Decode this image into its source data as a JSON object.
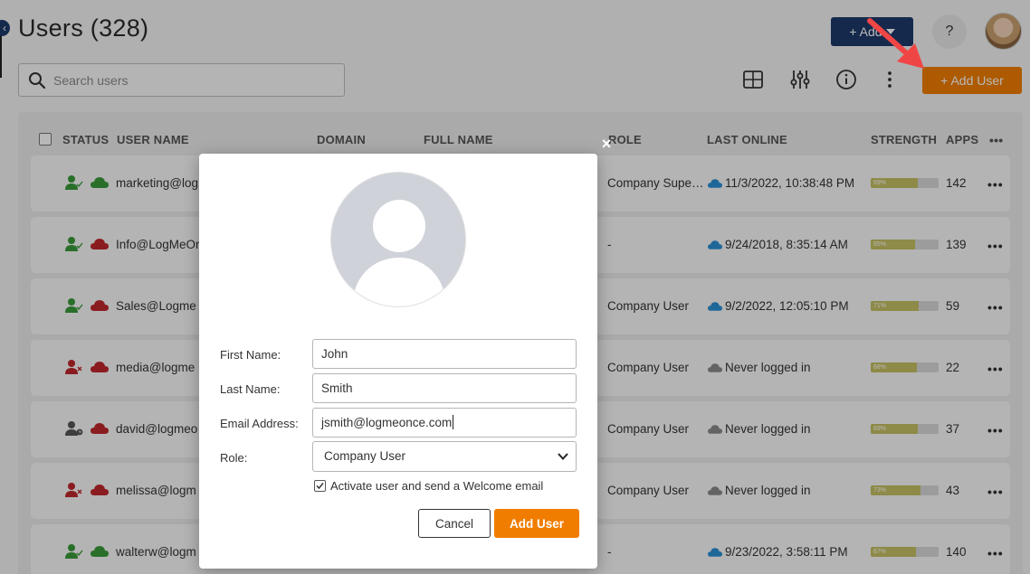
{
  "header": {
    "title": "Users (328)",
    "add_label": "+ Add",
    "help_label": "?",
    "add_user_label": "+ Add User"
  },
  "search": {
    "placeholder": "Search users"
  },
  "table": {
    "columns": [
      "STATUS",
      "USER NAME",
      "DOMAIN",
      "FULL NAME",
      "ROLE",
      "LAST ONLINE",
      "STRENGTH",
      "APPS"
    ],
    "more_label": "•••",
    "rows": [
      {
        "username": "marketing@log",
        "role": "Company Supe…",
        "last_online": "11/3/2022, 10:38:48 PM",
        "strength": 69,
        "strength_label": "69%",
        "apps": "142",
        "status_user": "active",
        "status_cloud": "green",
        "online_cloud": "blue"
      },
      {
        "username": "Info@LogMeOr",
        "role": "-",
        "last_online": "9/24/2018, 8:35:14 AM",
        "strength": 65,
        "strength_label": "65%",
        "apps": "139",
        "status_user": "active",
        "status_cloud": "red",
        "online_cloud": "blue"
      },
      {
        "username": "Sales@Logme",
        "role": "Company User",
        "last_online": "9/2/2022, 12:05:10 PM",
        "strength": 71,
        "strength_label": "71%",
        "apps": "59",
        "status_user": "active",
        "status_cloud": "red",
        "online_cloud": "blue"
      },
      {
        "username": "media@logme",
        "role": "Company User",
        "last_online": "Never logged in",
        "strength": 68,
        "strength_label": "68%",
        "apps": "22",
        "status_user": "inactive",
        "status_cloud": "red",
        "online_cloud": "grey"
      },
      {
        "username": "david@logmeo",
        "role": "Company User",
        "last_online": "Never logged in",
        "strength": 69,
        "strength_label": "69%",
        "apps": "37",
        "status_user": "pending",
        "status_cloud": "red",
        "online_cloud": "grey"
      },
      {
        "username": "melissa@logm",
        "role": "Company User",
        "last_online": "Never logged in",
        "strength": 73,
        "strength_label": "73%",
        "apps": "43",
        "status_user": "inactive",
        "status_cloud": "red",
        "online_cloud": "grey"
      },
      {
        "username": "walterw@logm",
        "role": "-",
        "last_online": "9/23/2022, 3:58:11 PM",
        "strength": 67,
        "strength_label": "67%",
        "apps": "140",
        "status_user": "active",
        "status_cloud": "green",
        "online_cloud": "blue"
      }
    ]
  },
  "modal": {
    "close_label": "×",
    "first_name_label": "First Name:",
    "first_name_value": "John",
    "last_name_label": "Last Name:",
    "last_name_value": "Smith",
    "email_label": "Email Address:",
    "email_value": "jsmith@logmeonce.com",
    "role_label": "Role:",
    "role_value": "Company User",
    "activate_label": "Activate user and send a Welcome email",
    "activate_checked": true,
    "cancel_label": "Cancel",
    "add_user_label": "Add User"
  },
  "colors": {
    "navy": "#1e3a6b",
    "orange": "#f07d00",
    "status_green": "#3a9a3a",
    "status_red": "#c0282d",
    "cloud_blue": "#2a8fd4",
    "cloud_grey": "#8a8a8a",
    "strength_fill": "#c5c063",
    "annotation_arrow": "#f04545"
  }
}
